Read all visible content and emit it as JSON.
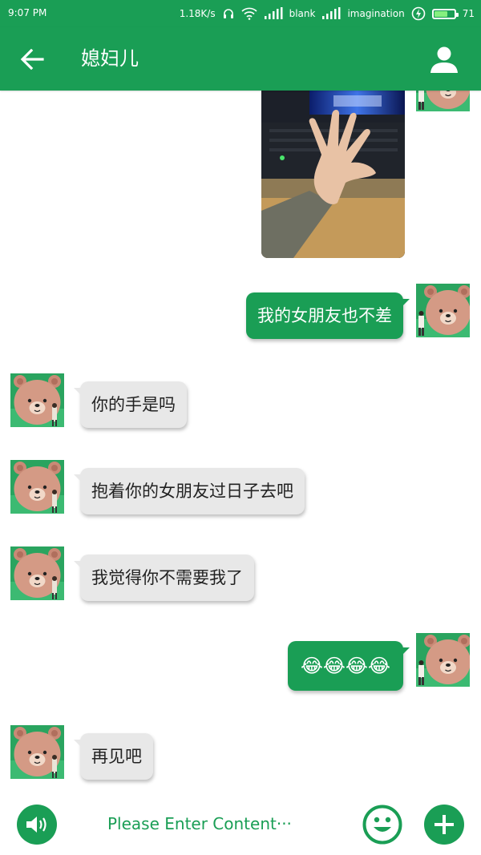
{
  "status_bar": {
    "time": "9:07 PM",
    "network_speed": "1.18K/s",
    "carrier_1": "blank",
    "carrier_2": "imagination",
    "battery_level": "71",
    "battery_fraction": 0.71
  },
  "header": {
    "title": "媳妇儿",
    "back_icon": "arrow-left-icon",
    "contact_icon": "person-icon"
  },
  "messages": [
    {
      "side": "out",
      "type": "image",
      "alt": ""
    },
    {
      "side": "out",
      "type": "text",
      "text": "我的女朋友也不差"
    },
    {
      "side": "in",
      "type": "text",
      "text": "你的手是吗"
    },
    {
      "side": "in",
      "type": "text",
      "text": "抱着你的女朋友过日子去吧"
    },
    {
      "side": "in",
      "type": "text",
      "text": "我觉得你不需要我了"
    },
    {
      "side": "out",
      "type": "text",
      "text": "😂😂😂😂"
    },
    {
      "side": "in",
      "type": "text",
      "text": "再见吧"
    }
  ],
  "input_bar": {
    "placeholder": "Please Enter Content···",
    "value": "",
    "voice_icon": "speaker-icon",
    "emoji_icon": "smiley-icon",
    "add_icon": "plus-icon"
  },
  "colors": {
    "brand": "#1a9e55",
    "incoming_bubble": "#e8e8e8",
    "outgoing_bubble": "#1a9e55"
  }
}
